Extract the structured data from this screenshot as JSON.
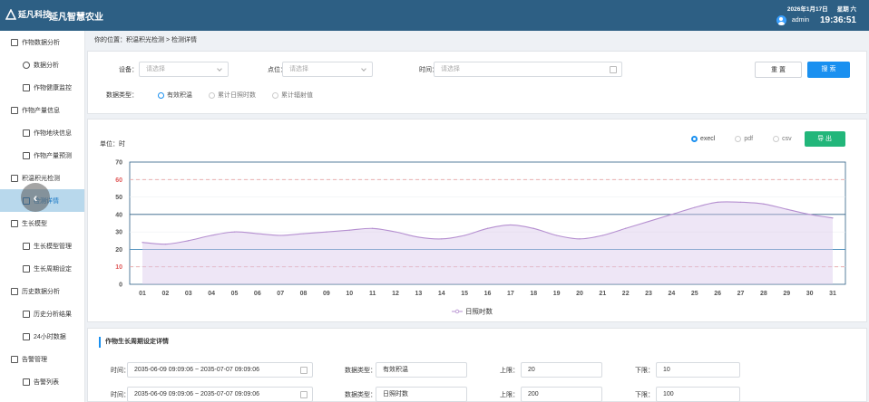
{
  "header": {
    "logo_text": "延凡科技",
    "app_title": "延凡智慧农业",
    "date": "2026年1月17日",
    "weekday": "星期 六",
    "user": "admin",
    "time": "19:36:51"
  },
  "sidebar": {
    "items": [
      {
        "label": "作物数据分析",
        "level": 1,
        "icon": "checkbox-icon"
      },
      {
        "label": "数据分析",
        "level": 2,
        "icon": "pie-icon"
      },
      {
        "label": "作物健康监控",
        "level": 2,
        "icon": "leaf-icon"
      },
      {
        "label": "作物产量信息",
        "level": 1,
        "icon": "edit-icon"
      },
      {
        "label": "作物地块信息",
        "level": 2,
        "icon": "edit-icon"
      },
      {
        "label": "作物产量预测",
        "level": 2,
        "icon": "edit-icon"
      },
      {
        "label": "积温积光检测",
        "level": 1,
        "icon": "monitor-icon"
      },
      {
        "label": "检测详情",
        "level": 2,
        "icon": "edit-icon",
        "active": true
      },
      {
        "label": "生长模型",
        "level": 1,
        "icon": "document-icon"
      },
      {
        "label": "生长模型管理",
        "level": 2,
        "icon": "edit-icon"
      },
      {
        "label": "生长周期设定",
        "level": 2,
        "icon": "edit-icon"
      },
      {
        "label": "历史数据分析",
        "level": 1,
        "icon": "document-icon"
      },
      {
        "label": "历史分析结果",
        "level": 2,
        "icon": "edit-icon"
      },
      {
        "label": "24小时数据",
        "level": 2,
        "icon": "edit-icon"
      },
      {
        "label": "告警管理",
        "level": 1,
        "icon": "bell-icon"
      },
      {
        "label": "告警列表",
        "level": 2,
        "icon": "edit-icon"
      }
    ]
  },
  "breadcrumb": "你的位置：积温积光检测 > 检测详情",
  "filters": {
    "device_label": "设备：",
    "device_placeholder": "请选择",
    "point_label": "点位：",
    "point_placeholder": "请选择",
    "time_label": "时间：",
    "time_placeholder": "请选择",
    "reset_label": "重 置",
    "search_label": "搜 索",
    "data_type_label": "数据类型：",
    "data_types": [
      "有效积温",
      "累计日照时数",
      "累计辐射值"
    ],
    "selected_data_type": "有效积温"
  },
  "chart_panel": {
    "unit_label": "单位：时",
    "export_options": [
      "execl",
      "pdf",
      "csv"
    ],
    "selected_export": "execl",
    "export_button": "导 出"
  },
  "chart_data": {
    "type": "line",
    "categories": [
      "01",
      "02",
      "03",
      "04",
      "05",
      "06",
      "07",
      "08",
      "09",
      "10",
      "11",
      "12",
      "13",
      "14",
      "15",
      "16",
      "17",
      "18",
      "19",
      "20",
      "21",
      "22",
      "23",
      "24",
      "25",
      "26",
      "27",
      "28",
      "29",
      "30",
      "31"
    ],
    "series": [
      {
        "name": "日照时数",
        "values": [
          24,
          23,
          25,
          28,
          30,
          29,
          28,
          29,
          30,
          31,
          32,
          30,
          27,
          26,
          28,
          32,
          34,
          32,
          28,
          26,
          28,
          32,
          36,
          40,
          44,
          47,
          47,
          46,
          43,
          40,
          38
        ]
      }
    ],
    "ylim": [
      0,
      70
    ],
    "yticks": [
      0,
      10,
      20,
      30,
      40,
      50,
      60,
      70
    ],
    "threshold_lines": [
      {
        "value": 10,
        "color": "#e8a3a3",
        "style": "dashed"
      },
      {
        "value": 20,
        "color": "#3f87b7",
        "style": "solid"
      },
      {
        "value": 40,
        "color": "#2d5f84",
        "style": "solid"
      },
      {
        "value": 60,
        "color": "#e8a3a3",
        "style": "dashed"
      }
    ],
    "red_ticks": [
      10,
      60
    ],
    "legend": [
      "日照时数"
    ],
    "legend_position": "bottom-center",
    "line_color": "#b58fd0"
  },
  "detail": {
    "title": "作物生长周期设定详情",
    "rows": [
      {
        "time_label": "时间：",
        "time_value": "2035-06-09  09:09:06  ~  2035-07-07  09:09:06",
        "type_label": "数据类型：",
        "type_value": "有效积温",
        "upper_label": "上限：",
        "upper_value": "20",
        "lower_label": "下限：",
        "lower_value": "10"
      },
      {
        "time_label": "时间：",
        "time_value": "2035-06-09  09:09:06  ~  2035-07-07  09:09:06",
        "type_label": "数据类型：",
        "type_value": "日照时数",
        "upper_label": "上限：",
        "upper_value": "200",
        "lower_label": "下限：",
        "lower_value": "100"
      }
    ]
  },
  "colors": {
    "header_bg": "#2d5f84",
    "primary": "#1a90f0",
    "export_green": "#22b67a",
    "active_menu_bg": "#b8d8ec"
  }
}
